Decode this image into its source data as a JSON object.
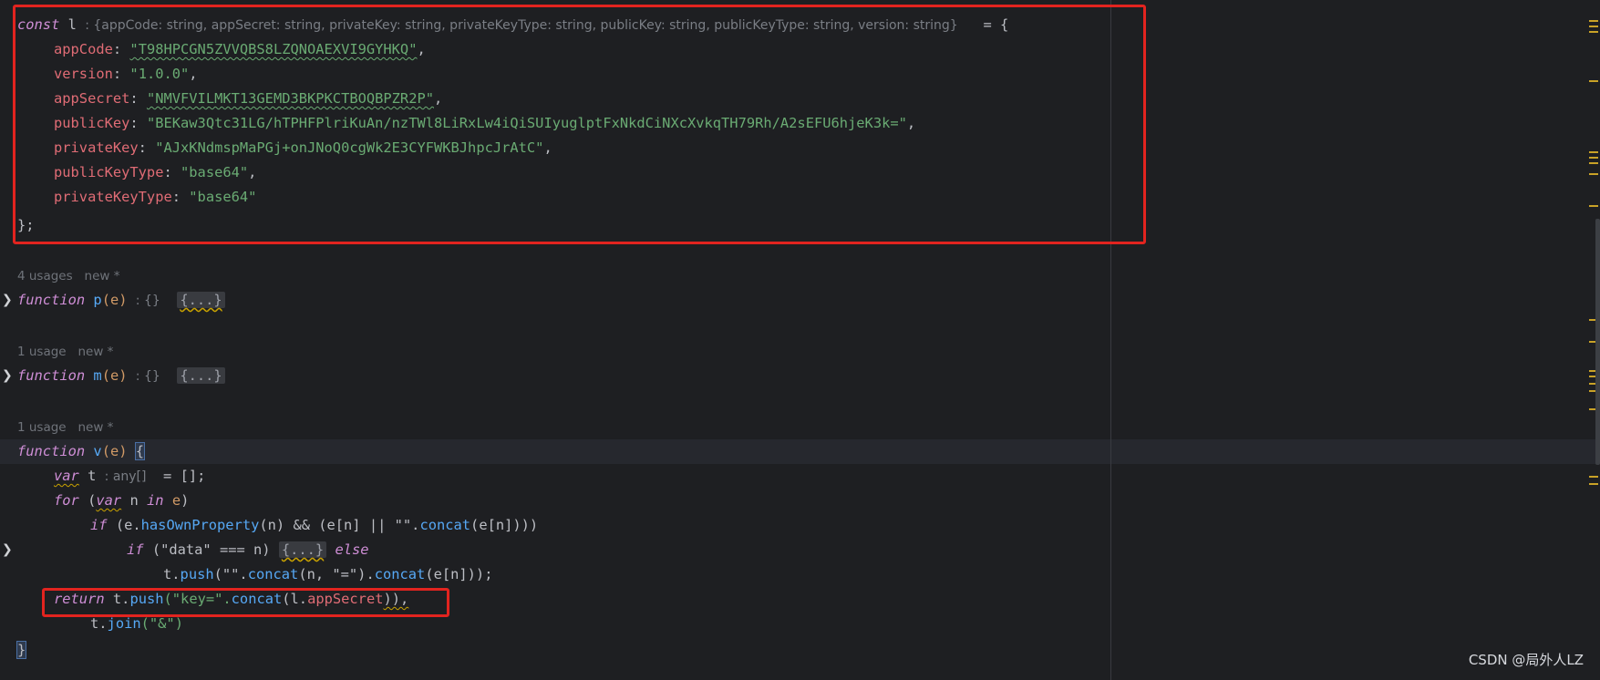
{
  "editor": {
    "const_block": {
      "kw_const": "const",
      "var_name": "l",
      "type_hint": ": {appCode: string, appSecret: string, privateKey: string, privateKeyType: string, publicKey: string, publicKeyType: string, version: string}",
      "assign": "= {",
      "entries": [
        {
          "key": "appCode",
          "value": "\"T98HPCGN5ZVVQBS8LZQNOAEXVI9GYHKQ\"",
          "tail": ","
        },
        {
          "key": "version",
          "value": "\"1.0.0\"",
          "tail": ","
        },
        {
          "key": "appSecret",
          "value": "\"NMVFVILMKT13GEMD3BKPKCTBOQBPZR2P\"",
          "tail": ","
        },
        {
          "key": "publicKey",
          "value": "\"BEKaw3Qtc31LG/hTPHFPlriKuAn/nzTWl8LiRxLw4iQiSUIyuglptFxNkdCiNXcXvkqTH79Rh/A2sEFU6hjeK3k=\"",
          "tail": ","
        },
        {
          "key": "privateKey",
          "value": "\"AJxKNdmspMaPGj+onJNoQ0cgWk2E3CYFWKBJhpcJrAtC\"",
          "tail": ","
        },
        {
          "key": "publicKeyType",
          "value": "\"base64\"",
          "tail": ","
        },
        {
          "key": "privateKeyType",
          "value": "\"base64\"",
          "tail": ""
        }
      ],
      "close": "};"
    },
    "func_p": {
      "usage": "4 usages   new *",
      "kw": "function",
      "name": "p",
      "params": "(e)",
      "hint": ": {}",
      "folded": "{...}"
    },
    "func_m": {
      "usage": "1 usage   new *",
      "kw": "function",
      "name": "m",
      "params": "(e)",
      "hint": ": {}",
      "folded": "{...}"
    },
    "func_v": {
      "usage": "1 usage   new *",
      "kw": "function",
      "name": "v",
      "params": "(e)",
      "open": "{",
      "lines": {
        "var_kw": "var",
        "var_t": "t",
        "var_hint": ": any[]",
        "var_rest": "= [];",
        "for_kw": "for",
        "for_var": "var",
        "for_n": "n",
        "for_in": "in",
        "for_e": "e",
        "if_kw": "if",
        "if_cond_a": "(e.",
        "has_own": "hasOwnProperty",
        "if_cond_b": "(n) && (e[n] || \"\".",
        "concat1": "concat",
        "if_cond_c": "(e[n])))",
        "if2_kw": "if",
        "if2_cond": "(\"data\" === n)",
        "if2_folded": "{...}",
        "else_kw": "else",
        "push_a": "t.",
        "push_fn": "push",
        "push_b": "(\"\".",
        "push_concat": "concat",
        "push_c": "(n, \"=\").",
        "push_concat2": "concat",
        "push_d": "(e[n]));",
        "return_kw": "return",
        "ret_a": "t.",
        "ret_push": "push",
        "ret_str": "(\"key=\".",
        "ret_concat": "concat",
        "ret_b": "(l.",
        "ret_prop": "appSecret",
        "ret_c": ")),",
        "join_a": "t.",
        "join_fn": "join",
        "join_b": "(\"&\")",
        "close": "}"
      }
    }
  },
  "watermark": "CSDN @局外人LZ",
  "colors": {
    "background": "#1e1f22",
    "highlight_box": "#e2241f",
    "keyword": "#cf8ed6",
    "string": "#6aab73",
    "property": "#c77dbb"
  }
}
